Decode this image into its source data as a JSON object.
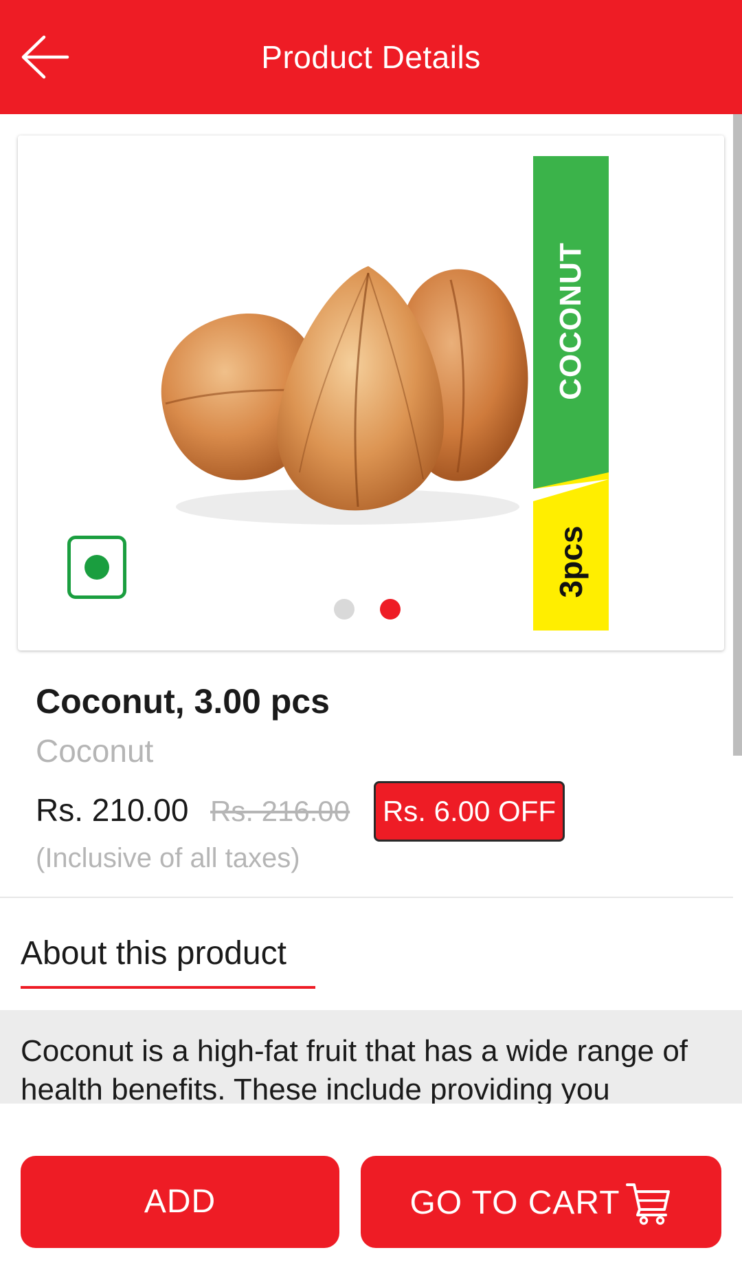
{
  "header": {
    "title": "Product Details",
    "back_icon": "arrow-left-icon",
    "color": "#ee1c25"
  },
  "product_card": {
    "image_icon": "coconut-image",
    "veg_indicator_icon": "veg-indicator-icon",
    "carousel": {
      "total": 2,
      "active_index": 2
    },
    "tag": {
      "name": "COCONUT",
      "quantity": "3pcs",
      "name_color": "#3bb34a",
      "quantity_color": "#ffee00"
    }
  },
  "product": {
    "title": "Coconut, 3.00 pcs",
    "subtitle": "Coconut",
    "price": "Rs. 210.00",
    "mrp": "Rs. 216.00",
    "discount": "Rs. 6.00 OFF",
    "tax_note": "(Inclusive of all taxes)"
  },
  "about": {
    "tab_label": "About this product",
    "description": "Coconut is a high-fat fruit that has a wide range of health benefits. These include providing you"
  },
  "actions": {
    "add_label": "ADD",
    "cart_label": "GO TO CART",
    "cart_icon": "shopping-cart-icon"
  }
}
